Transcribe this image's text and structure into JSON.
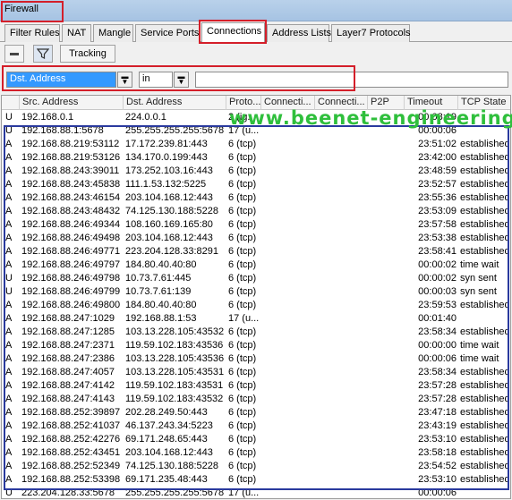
{
  "window": {
    "title": "Firewall"
  },
  "tabs": [
    {
      "label": "Filter Rules"
    },
    {
      "label": "NAT"
    },
    {
      "label": "Mangle"
    },
    {
      "label": "Service Ports"
    },
    {
      "label": "Connections"
    },
    {
      "label": "Address Lists"
    },
    {
      "label": "Layer7 Protocols"
    }
  ],
  "toolbar": {
    "tracking_label": "Tracking"
  },
  "filter": {
    "field": "Dst. Address",
    "operator": "in",
    "value": ""
  },
  "columns": [
    "Src. Address",
    "Dst. Address",
    "Proto...",
    "Connecti...",
    "Connecti...",
    "P2P",
    "Timeout",
    "TCP State"
  ],
  "rows": [
    {
      "flag": "U",
      "src": "192.168.0.1",
      "dst": "224.0.0.1",
      "proto": "2 (ig...",
      "timeout": "00:08:19",
      "state": ""
    },
    {
      "flag": "U",
      "src": "192.168.88.1:5678",
      "dst": "255.255.255.255:5678",
      "proto": "17 (u...",
      "timeout": "00:00:06",
      "state": ""
    },
    {
      "flag": "A",
      "src": "192.168.88.219:53112",
      "dst": "17.172.239.81:443",
      "proto": "6 (tcp)",
      "timeout": "23:51:02",
      "state": "established"
    },
    {
      "flag": "A",
      "src": "192.168.88.219:53126",
      "dst": "134.170.0.199:443",
      "proto": "6 (tcp)",
      "timeout": "23:42:00",
      "state": "established"
    },
    {
      "flag": "A",
      "src": "192.168.88.243:39011",
      "dst": "173.252.103.16:443",
      "proto": "6 (tcp)",
      "timeout": "23:48:59",
      "state": "established"
    },
    {
      "flag": "A",
      "src": "192.168.88.243:45838",
      "dst": "111.1.53.132:5225",
      "proto": "6 (tcp)",
      "timeout": "23:52:57",
      "state": "established"
    },
    {
      "flag": "A",
      "src": "192.168.88.243:46154",
      "dst": "203.104.168.12:443",
      "proto": "6 (tcp)",
      "timeout": "23:55:36",
      "state": "established"
    },
    {
      "flag": "A",
      "src": "192.168.88.243:48432",
      "dst": "74.125.130.188:5228",
      "proto": "6 (tcp)",
      "timeout": "23:53:09",
      "state": "established"
    },
    {
      "flag": "A",
      "src": "192.168.88.246:49344",
      "dst": "108.160.169.165:80",
      "proto": "6 (tcp)",
      "timeout": "23:57:58",
      "state": "established"
    },
    {
      "flag": "A",
      "src": "192.168.88.246:49498",
      "dst": "203.104.168.12:443",
      "proto": "6 (tcp)",
      "timeout": "23:53:38",
      "state": "established"
    },
    {
      "flag": "A",
      "src": "192.168.88.246:49771",
      "dst": "223.204.128.33:8291",
      "proto": "6 (tcp)",
      "timeout": "23:58:41",
      "state": "established"
    },
    {
      "flag": "A",
      "src": "192.168.88.246:49797",
      "dst": "184.80.40.40:80",
      "proto": "6 (tcp)",
      "timeout": "00:00:02",
      "state": "time wait"
    },
    {
      "flag": "U",
      "src": "192.168.88.246:49798",
      "dst": "10.73.7.61:445",
      "proto": "6 (tcp)",
      "timeout": "00:00:02",
      "state": "syn sent"
    },
    {
      "flag": "U",
      "src": "192.168.88.246:49799",
      "dst": "10.73.7.61:139",
      "proto": "6 (tcp)",
      "timeout": "00:00:03",
      "state": "syn sent"
    },
    {
      "flag": "A",
      "src": "192.168.88.246:49800",
      "dst": "184.80.40.40:80",
      "proto": "6 (tcp)",
      "timeout": "23:59:53",
      "state": "established"
    },
    {
      "flag": "A",
      "src": "192.168.88.247:1029",
      "dst": "192.168.88.1:53",
      "proto": "17 (u...",
      "timeout": "00:01:40",
      "state": ""
    },
    {
      "flag": "A",
      "src": "192.168.88.247:1285",
      "dst": "103.13.228.105:43532",
      "proto": "6 (tcp)",
      "timeout": "23:58:34",
      "state": "established"
    },
    {
      "flag": "A",
      "src": "192.168.88.247:2371",
      "dst": "119.59.102.183:43536",
      "proto": "6 (tcp)",
      "timeout": "00:00:00",
      "state": "time wait"
    },
    {
      "flag": "A",
      "src": "192.168.88.247:2386",
      "dst": "103.13.228.105:43536",
      "proto": "6 (tcp)",
      "timeout": "00:00:06",
      "state": "time wait"
    },
    {
      "flag": "A",
      "src": "192.168.88.247:4057",
      "dst": "103.13.228.105:43531",
      "proto": "6 (tcp)",
      "timeout": "23:58:34",
      "state": "established"
    },
    {
      "flag": "A",
      "src": "192.168.88.247:4142",
      "dst": "119.59.102.183:43531",
      "proto": "6 (tcp)",
      "timeout": "23:57:28",
      "state": "established"
    },
    {
      "flag": "A",
      "src": "192.168.88.247:4143",
      "dst": "119.59.102.183:43532",
      "proto": "6 (tcp)",
      "timeout": "23:57:28",
      "state": "established"
    },
    {
      "flag": "A",
      "src": "192.168.88.252:39897",
      "dst": "202.28.249.50:443",
      "proto": "6 (tcp)",
      "timeout": "23:47:18",
      "state": "established"
    },
    {
      "flag": "A",
      "src": "192.168.88.252:41037",
      "dst": "46.137.243.34:5223",
      "proto": "6 (tcp)",
      "timeout": "23:43:19",
      "state": "established"
    },
    {
      "flag": "A",
      "src": "192.168.88.252:42276",
      "dst": "69.171.248.65:443",
      "proto": "6 (tcp)",
      "timeout": "23:53:10",
      "state": "established"
    },
    {
      "flag": "A",
      "src": "192.168.88.252:43451",
      "dst": "203.104.168.12:443",
      "proto": "6 (tcp)",
      "timeout": "23:58:18",
      "state": "established"
    },
    {
      "flag": "A",
      "src": "192.168.88.252:52349",
      "dst": "74.125.130.188:5228",
      "proto": "6 (tcp)",
      "timeout": "23:54:52",
      "state": "established"
    },
    {
      "flag": "A",
      "src": "192.168.88.252:53398",
      "dst": "69.171.235.48:443",
      "proto": "6 (tcp)",
      "timeout": "23:53:10",
      "state": "established"
    },
    {
      "flag": "U",
      "src": "223.204.128.33:5678",
      "dst": "255.255.255.255:5678",
      "proto": "17 (u...",
      "timeout": "00:00:06",
      "state": ""
    }
  ],
  "watermark": "www.beenet-engineering",
  "colors": {
    "annotation_red": "#d41f2a",
    "annotation_blue": "#2a3a9e",
    "watermark_green": "#2fbf3c"
  }
}
